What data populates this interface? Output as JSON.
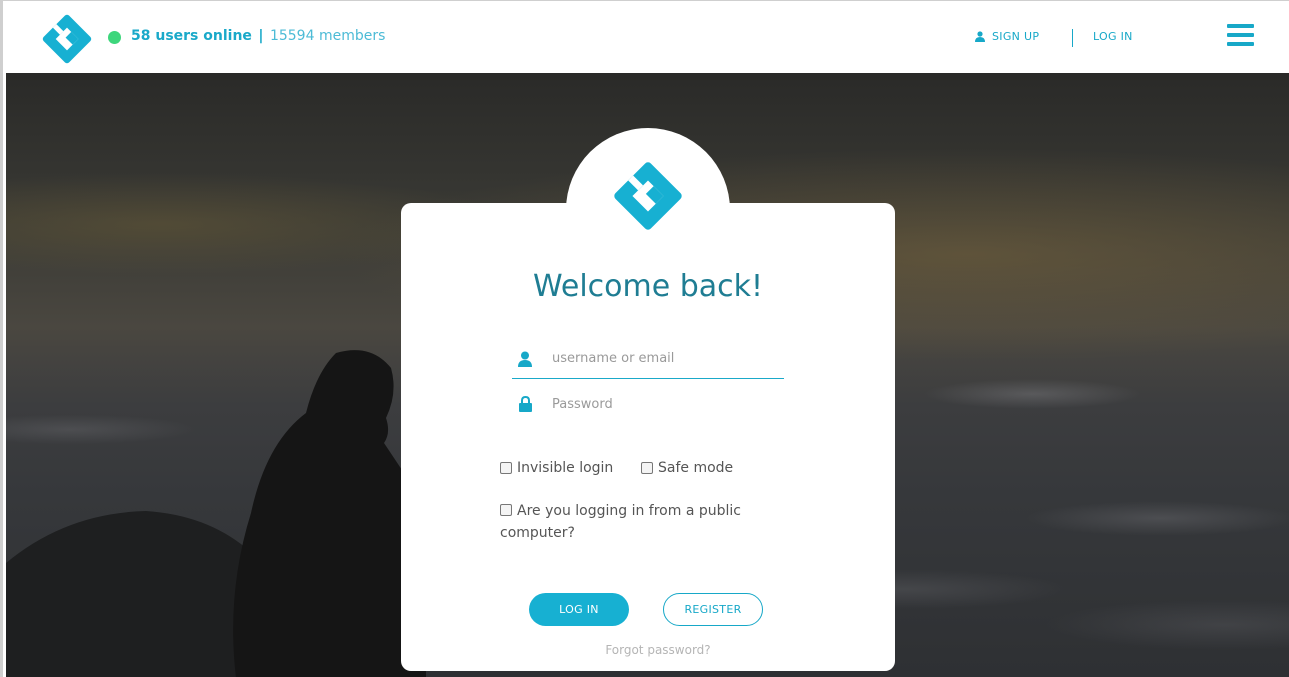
{
  "header": {
    "users_online": "58 users online",
    "separator": "|",
    "members": "15594 members",
    "signup_label": "SIGN UP",
    "login_label": "LOG IN"
  },
  "login": {
    "welcome": "Welcome back!",
    "username_placeholder": "username or email",
    "password_placeholder": "Password",
    "invisible_login": "Invisible login",
    "safe_mode": "Safe mode",
    "public_computer": "Are you logging in from a public computer?",
    "login_button": "LOG IN",
    "register_button": "REGISTER",
    "forgot": "Forgot password?"
  },
  "icons": {
    "logo": "logo-icon",
    "online": "online-status-icon",
    "signup": "user-icon",
    "menu": "hamburger-menu-icon",
    "username": "user-icon",
    "password": "lock-icon"
  },
  "colors": {
    "accent": "#17a8c8",
    "heading": "#1f7d93",
    "online": "#3ed67c"
  }
}
